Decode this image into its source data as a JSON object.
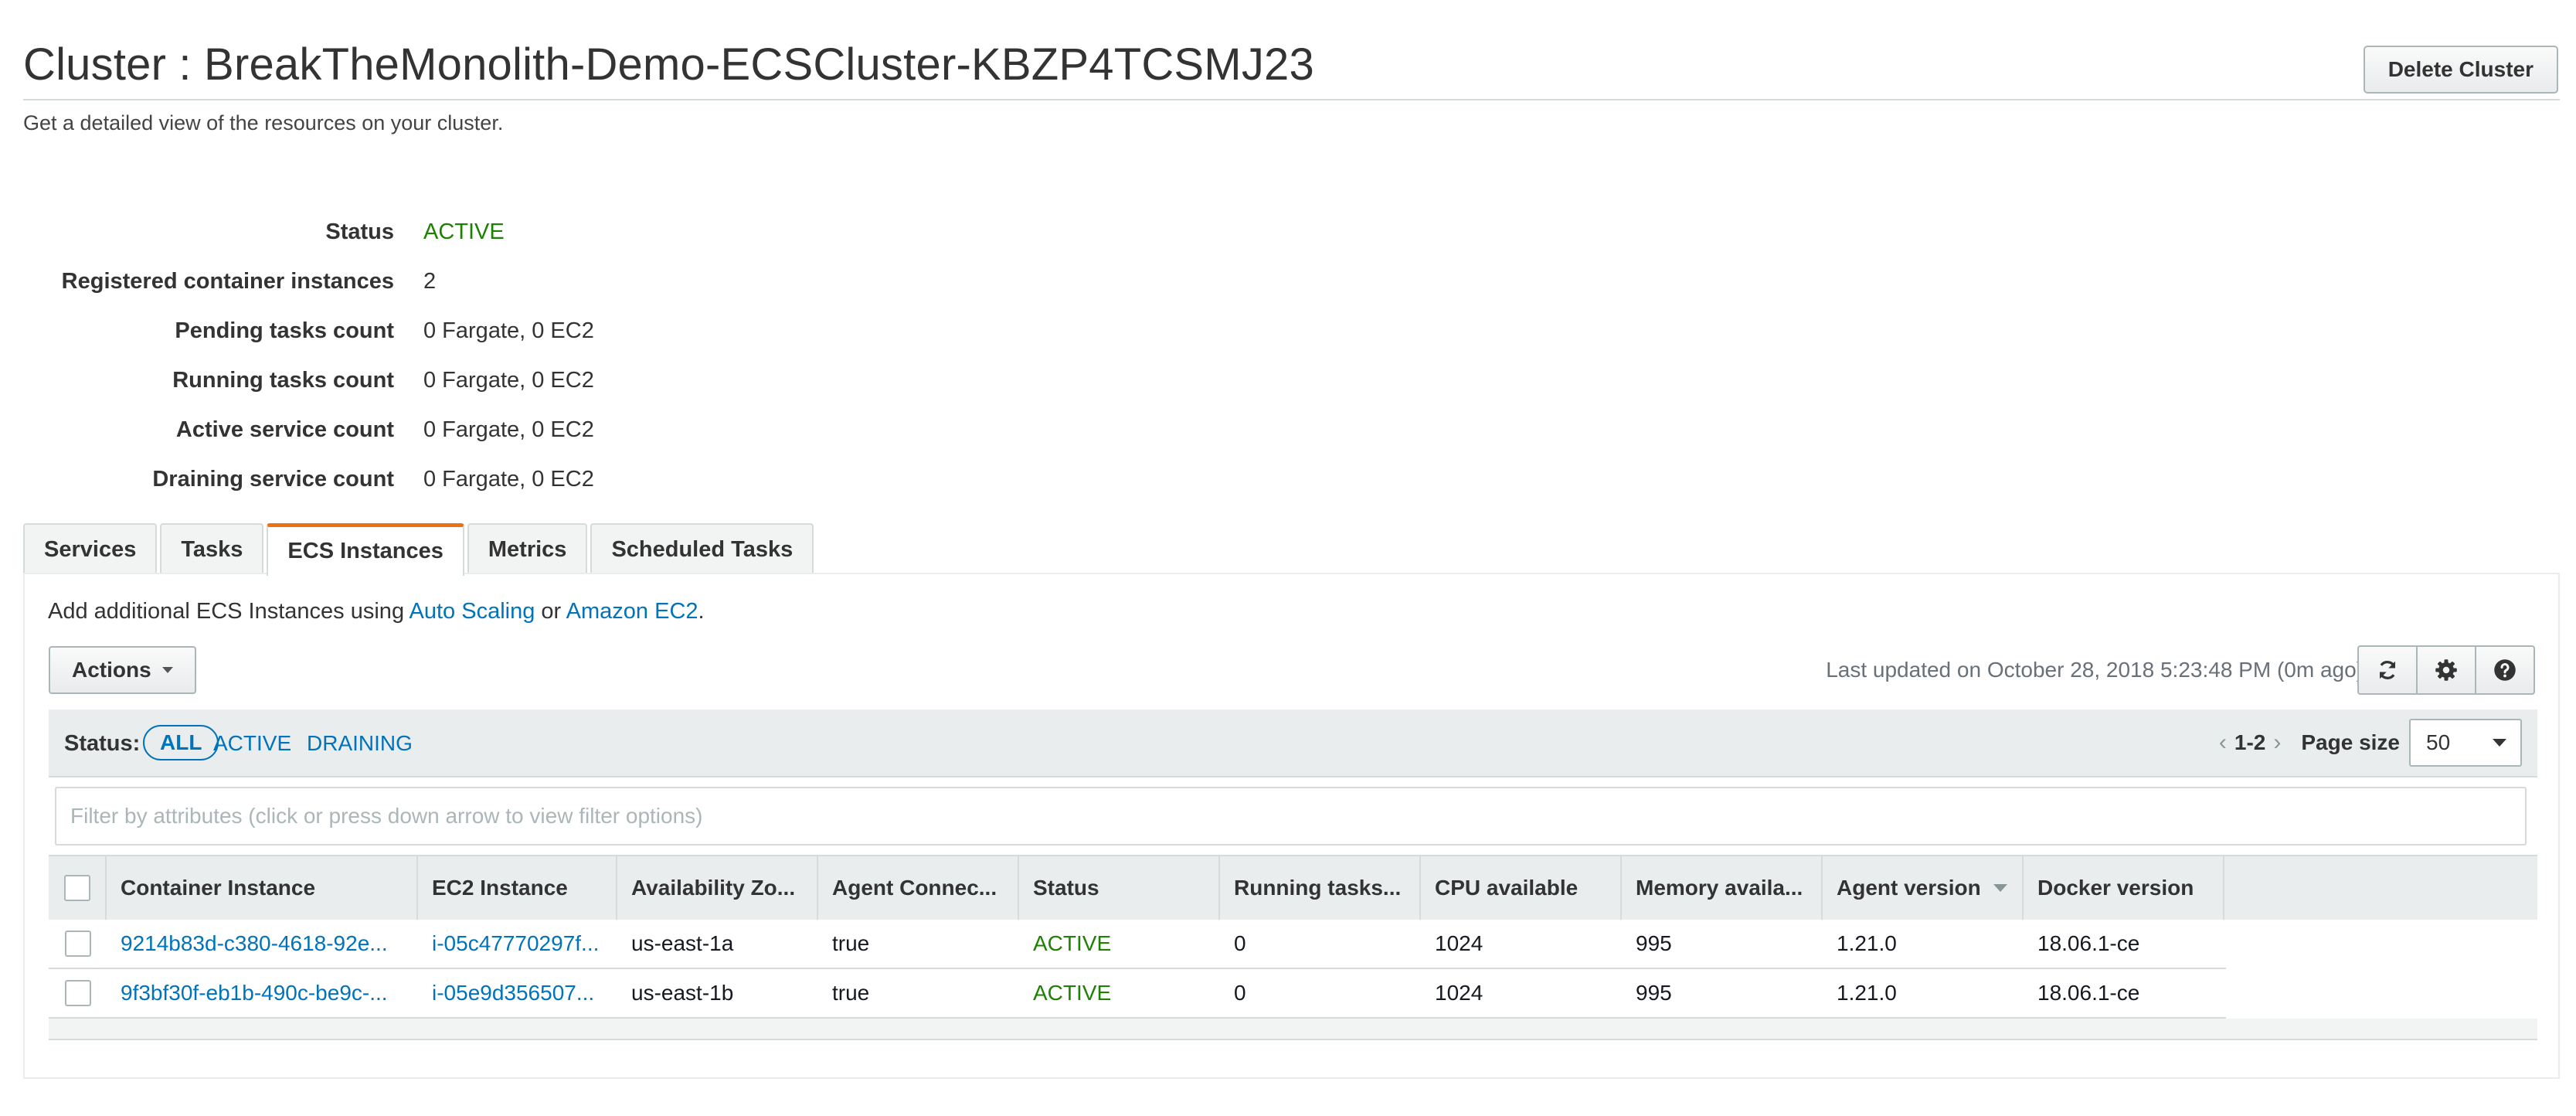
{
  "page": {
    "title": "Cluster : BreakTheMonolith-Demo-ECSCluster-KBZP4TCSMJ23",
    "subtitle": "Get a detailed view of the resources on your cluster.",
    "delete_label": "Delete Cluster"
  },
  "summary": [
    {
      "label": "Status",
      "value": "ACTIVE"
    },
    {
      "label": "Registered container instances",
      "value": "2"
    },
    {
      "label": "Pending tasks count",
      "value": "0 Fargate, 0 EC2"
    },
    {
      "label": "Running tasks count",
      "value": "0 Fargate, 0 EC2"
    },
    {
      "label": "Active service count",
      "value": "0 Fargate, 0 EC2"
    },
    {
      "label": "Draining service count",
      "value": "0 Fargate, 0 EC2"
    }
  ],
  "tabs": [
    {
      "label": "Services"
    },
    {
      "label": "Tasks"
    },
    {
      "label": "ECS Instances"
    },
    {
      "label": "Metrics"
    },
    {
      "label": "Scheduled Tasks"
    }
  ],
  "active_tab": "ECS Instances",
  "instances_panel": {
    "add_prefix": "Add additional ECS Instances using ",
    "add_link1": "Auto Scaling",
    "add_mid": " or ",
    "add_link2": "Amazon EC2",
    "add_suffix": ".",
    "actions_label": "Actions",
    "last_updated": "Last updated on October 28, 2018 5:23:48 PM (0m ago)",
    "toolbar_icons": [
      "refresh-icon",
      "gear-icon",
      "help-icon"
    ],
    "status_label": "Status:",
    "status_filters": [
      "ALL",
      "ACTIVE",
      "DRAINING"
    ],
    "pager_range": "1-2",
    "page_size_label": "Page size",
    "page_size": "50",
    "filter_placeholder": "Filter by attributes (click or press down arrow to view filter options)",
    "columns": [
      "Container Instance",
      "EC2 Instance",
      "Availability Zo...",
      "Agent Connec...",
      "Status",
      "Running tasks...",
      "CPU available",
      "Memory availa...",
      "Agent version",
      "Docker version"
    ],
    "rows": [
      [
        "9214b83d-c380-4618-92e...",
        "i-05c47770297f...",
        "us-east-1a",
        "true",
        "ACTIVE",
        "0",
        "1024",
        "995",
        "1.21.0",
        "18.06.1-ce"
      ],
      [
        "9f3bf30f-eb1b-490c-be9c-...",
        "i-05e9d356507...",
        "us-east-1b",
        "true",
        "ACTIVE",
        "0",
        "1024",
        "995",
        "1.21.0",
        "18.06.1-ce"
      ]
    ]
  },
  "colors": {
    "link": "#0073bb",
    "active_status": "#1d8102",
    "tab_accent": "#ec7211"
  }
}
